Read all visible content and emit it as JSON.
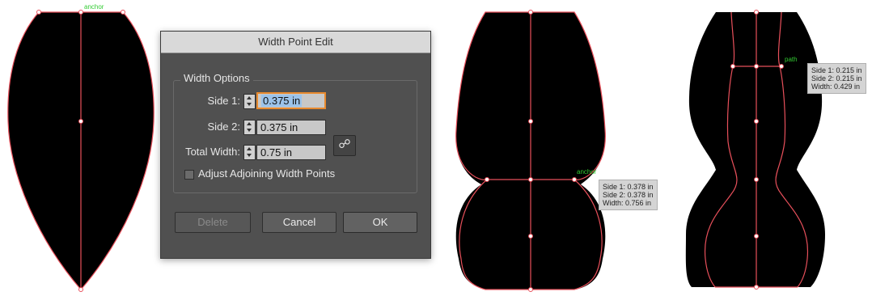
{
  "dialog": {
    "title": "Width Point Edit",
    "group_title": "Width Options",
    "side1_label": "Side 1:",
    "side1_value": "0.375 in",
    "side2_label": "Side 2:",
    "side2_value": "0.375 in",
    "total_label": "Total Width:",
    "total_value": "0.75 in",
    "link_icon": "chain-link-icon",
    "adjust_label": "Adjust Adjoining Width Points",
    "adjust_checked": false,
    "delete_label": "Delete",
    "cancel_label": "Cancel",
    "ok_label": "OK"
  },
  "canvas": {
    "shape1_label": "anchor",
    "shape2_label": "anchor",
    "shape3_label": "path",
    "tooltip1": {
      "side1": "Side 1: 0.378 in",
      "side2": "Side 2: 0.378 in",
      "width": "Width:  0.756 in"
    },
    "tooltip2": {
      "side1": "Side 1: 0.215 in",
      "side2": "Side 2: 0.215 in",
      "width": "Width:  0.429 in"
    }
  },
  "colors": {
    "guide": "#e8505b",
    "smart_label": "#33cc33",
    "fill": "#000000"
  }
}
